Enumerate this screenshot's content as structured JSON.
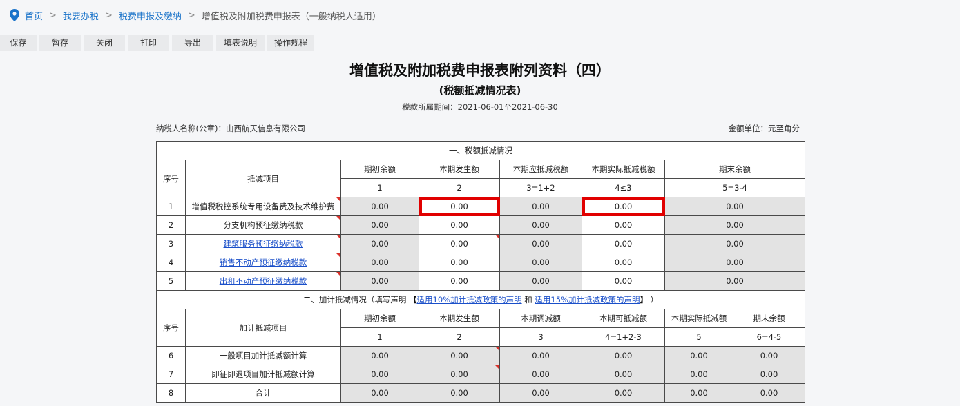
{
  "breadcrumb": {
    "home": "首页",
    "l1": "我要办税",
    "l2": "税费申报及缴纳",
    "current": "增值税及附加税费申报表（一般纳税人适用）",
    "sep": ">"
  },
  "toolbar": [
    "保存",
    "暂存",
    "关闭",
    "打印",
    "导出",
    "填表说明",
    "操作规程"
  ],
  "header": {
    "title": "增值税及附加税费申报表附列资料（四）",
    "subtitle": "(税额抵减情况表)",
    "period": "税款所属期间：2021-06-01至2021-06-30",
    "taxpayer": "纳税人名称(公章)：山西航天信息有限公司",
    "unit": "金额单位：元至角分"
  },
  "section1": {
    "title": "一、税额抵减情况",
    "col_seq": "序号",
    "col_item": "抵减项目",
    "cols": [
      "期初余额",
      "本期发生额",
      "本期应抵减税额",
      "本期实际抵减税额",
      "期末余额"
    ],
    "formulas": [
      "1",
      "2",
      "3=1+2",
      "4≤3",
      "5=3-4"
    ],
    "rows": [
      {
        "seq": "1",
        "item": "增值税税控系统专用设备费及技术维护费",
        "v1": "0.00",
        "v2": "0.00",
        "v3": "0.00",
        "v4": "0.00",
        "v5": "0.00"
      },
      {
        "seq": "2",
        "item": "分支机构预征缴纳税款",
        "v1": "0.00",
        "v2": "0.00",
        "v3": "0.00",
        "v4": "0.00",
        "v5": "0.00"
      },
      {
        "seq": "3",
        "item": "建筑服务预征缴纳税款",
        "v1": "0.00",
        "v2": "0.00",
        "v3": "0.00",
        "v4": "0.00",
        "v5": "0.00"
      },
      {
        "seq": "4",
        "item": "销售不动产预征缴纳税款",
        "v1": "0.00",
        "v2": "0.00",
        "v3": "0.00",
        "v4": "0.00",
        "v5": "0.00"
      },
      {
        "seq": "5",
        "item": "出租不动产预征缴纳税款",
        "v1": "0.00",
        "v2": "0.00",
        "v3": "0.00",
        "v4": "0.00",
        "v5": "0.00"
      }
    ]
  },
  "section2": {
    "title_prefix": "二、加计抵减情况（填写声明",
    "bracket_open": "【",
    "link1": "适用10%加计抵减政策的声明",
    "and": " 和 ",
    "link2": "适用15%加计抵减政策的声明",
    "bracket_close": "】",
    "title_suffix": "）",
    "col_seq": "序号",
    "col_item": "加计抵减项目",
    "cols": [
      "期初余额",
      "本期发生额",
      "本期调减额",
      "本期可抵减额",
      "本期实际抵减额",
      "期末余额"
    ],
    "formulas": [
      "1",
      "2",
      "3",
      "4=1+2-3",
      "5",
      "6=4-5"
    ],
    "rows": [
      {
        "seq": "6",
        "item": "一般项目加计抵减额计算",
        "v1": "0.00",
        "v2": "0.00",
        "v3": "0.00",
        "v4": "0.00",
        "v5": "0.00",
        "v6": "0.00"
      },
      {
        "seq": "7",
        "item": "即征即退项目加计抵减额计算",
        "v1": "0.00",
        "v2": "0.00",
        "v3": "0.00",
        "v4": "0.00",
        "v5": "0.00",
        "v6": "0.00"
      },
      {
        "seq": "8",
        "item": "合计",
        "v1": "0.00",
        "v2": "0.00",
        "v3": "0.00",
        "v4": "0.00",
        "v5": "0.00",
        "v6": "0.00"
      }
    ]
  },
  "colors": {
    "link": "#1a4fc9",
    "highlight": "#e10000",
    "readonly_cell": "#e3e3e3",
    "flag": "#d9302a"
  }
}
